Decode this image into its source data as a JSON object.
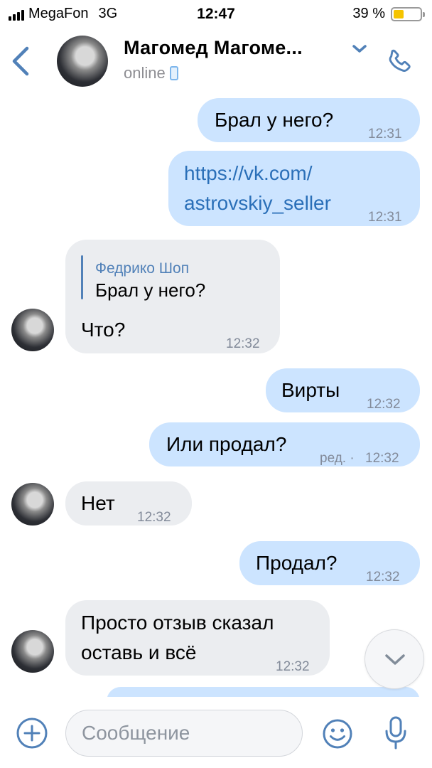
{
  "status_bar": {
    "carrier": "MegaFon",
    "network": "3G",
    "time": "12:47",
    "battery": "39 %",
    "battery_level": 0.39,
    "battery_color": "#f5c400"
  },
  "header": {
    "back_icon": "chevron-left-icon",
    "contact_name": "Магомед Магоме...",
    "status": "online",
    "status_device_icon": "mobile-phone-icon",
    "menu_icon": "chevron-down-icon",
    "call_icon": "phone-icon"
  },
  "messages": [
    {
      "direction": "out",
      "text": "Брал у него?",
      "time": "12:31"
    },
    {
      "direction": "out",
      "text_line1": "https://vk.com/",
      "text_line2": "astrovskiy_seller",
      "time": "12:31",
      "is_link": true
    },
    {
      "direction": "in",
      "reply_author": "Федрико Шоп",
      "reply_text": "Брал у него?",
      "text": "Что?",
      "time": "12:32"
    },
    {
      "direction": "out",
      "text": "Вирты",
      "time": "12:32"
    },
    {
      "direction": "out",
      "text": "Или продал?",
      "edited": "ред. ·",
      "time": "12:32"
    },
    {
      "direction": "in",
      "text": "Нет",
      "time": "12:32"
    },
    {
      "direction": "out",
      "text": "Продал?",
      "time": "12:32"
    },
    {
      "direction": "in",
      "text_line1": "Просто отзыв сказал",
      "text_line2": "оставь и всё",
      "time": "12:32"
    }
  ],
  "composer": {
    "placeholder": "Сообщение",
    "add_icon": "plus-circle-icon",
    "emoji_icon": "smiley-icon",
    "mic_icon": "microphone-icon"
  },
  "colors": {
    "accent": "#5181b8",
    "outgoing_bubble": "#cce4ff",
    "incoming_bubble": "#ebedf0",
    "link": "#2a6fb8"
  }
}
